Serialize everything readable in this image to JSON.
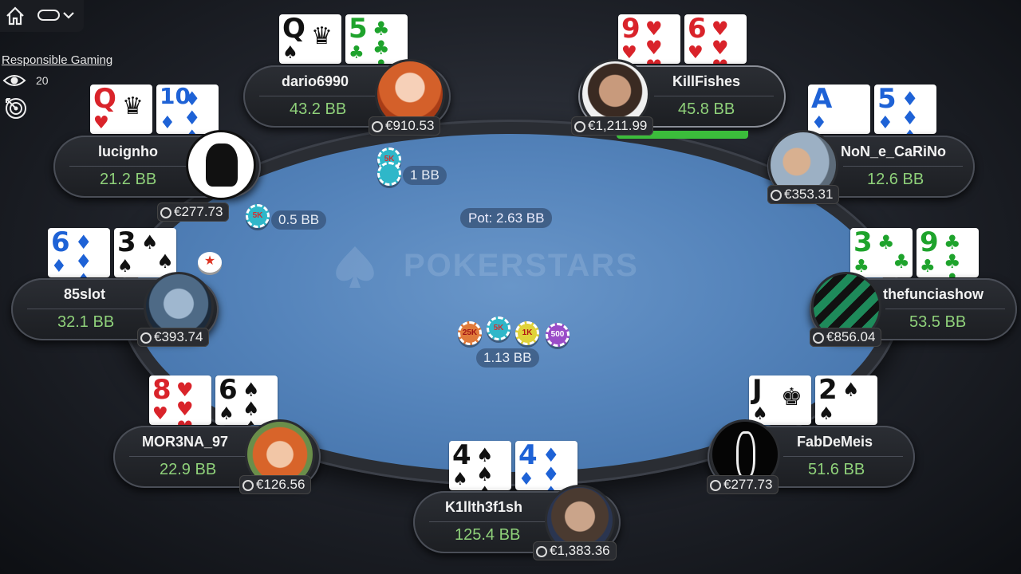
{
  "toolbar": {
    "responsible_gaming": "Responsible Gaming",
    "spectators": "20"
  },
  "table": {
    "watermark": "POKERSTARS",
    "pot": "Pot: 2.63 BB",
    "center_bet": "1.13 BB",
    "chips_center": [
      "25K",
      "5K",
      "1K",
      "500"
    ]
  },
  "bets": {
    "dario": {
      "amount": "1 BB",
      "chip": "5K"
    },
    "lucignho": {
      "amount": "0.5 BB",
      "chip": "5K"
    }
  },
  "players": {
    "dario6990": {
      "name": "dario6990",
      "stack": "43.2 BB",
      "money": "€910.53",
      "cards": [
        {
          "rank": "Q",
          "suit": "♠"
        },
        {
          "rank": "5",
          "suit": "♣"
        }
      ]
    },
    "killfishes": {
      "name": "KillFishes",
      "stack": "45.8 BB",
      "money": "€1,211.99",
      "cards": [
        {
          "rank": "9",
          "suit": "♥"
        },
        {
          "rank": "6",
          "suit": "♥"
        }
      ]
    },
    "lucignho": {
      "name": "lucignho",
      "stack": "21.2 BB",
      "money": "€277.73",
      "cards": [
        {
          "rank": "Q",
          "suit": "♥"
        },
        {
          "rank": "10",
          "suit": "♦"
        }
      ]
    },
    "none_carino": {
      "name": "NoN_e_CaRiNo",
      "stack": "12.6 BB",
      "money": "€353.31",
      "cards": [
        {
          "rank": "A",
          "suit": "♦"
        },
        {
          "rank": "5",
          "suit": "♦"
        }
      ]
    },
    "slot85": {
      "name": "85slot",
      "stack": "32.1 BB",
      "money": "€393.74",
      "cards": [
        {
          "rank": "6",
          "suit": "♦"
        },
        {
          "rank": "3",
          "suit": "♠"
        }
      ]
    },
    "thefunciashow": {
      "name": "thefunciashow",
      "stack": "53.5 BB",
      "money": "€856.04",
      "cards": [
        {
          "rank": "3",
          "suit": "♣"
        },
        {
          "rank": "9",
          "suit": "♣"
        }
      ]
    },
    "morena": {
      "name": "MOR3NA_97",
      "stack": "22.9 BB",
      "money": "€126.56",
      "cards": [
        {
          "rank": "8",
          "suit": "♥"
        },
        {
          "rank": "6",
          "suit": "♠"
        }
      ]
    },
    "fabdemeis": {
      "name": "FabDeMeis",
      "stack": "51.6 BB",
      "money": "€277.73",
      "cards": [
        {
          "rank": "J",
          "suit": "♠"
        },
        {
          "rank": "2",
          "suit": "♠"
        }
      ]
    },
    "hero": {
      "name": "K1llth3f1sh",
      "stack": "125.4 BB",
      "money": "€1,383.36",
      "cards": [
        {
          "rank": "4",
          "suit": "♠"
        },
        {
          "rank": "4",
          "suit": "♦"
        }
      ]
    }
  },
  "colors": {
    "felt": "#5584bb",
    "stack_green": "#8fd17a",
    "heart": "#d9232a",
    "diamond": "#1e62d6",
    "club": "#1ea32c"
  }
}
